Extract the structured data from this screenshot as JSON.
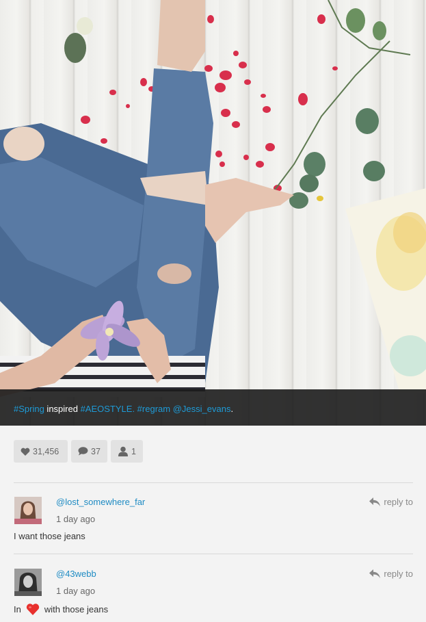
{
  "post": {
    "caption": {
      "tag1": "#Spring",
      "text1": " inspired ",
      "tag2": "#AEOSTYLE",
      "text2": ". ",
      "tag3": "#regram",
      "text3": " ",
      "mention": "@Jessi_evans",
      "text4": "."
    }
  },
  "stats": {
    "likes": "31,456",
    "comments": "37",
    "users": "1"
  },
  "colors": {
    "link": "#1e9bd7",
    "username": "#1e8bc3",
    "heart": "#e8302d"
  },
  "comments": [
    {
      "username": "@lost_somewhere_far",
      "time": "1 day ago",
      "text": "I want those jeans",
      "reply_label": "reply to"
    },
    {
      "username": "@43webb",
      "time": "1 day ago",
      "text_before": "In",
      "text_icon": "heart-emoji",
      "text_after": "with those jeans",
      "reply_label": "reply to"
    }
  ]
}
